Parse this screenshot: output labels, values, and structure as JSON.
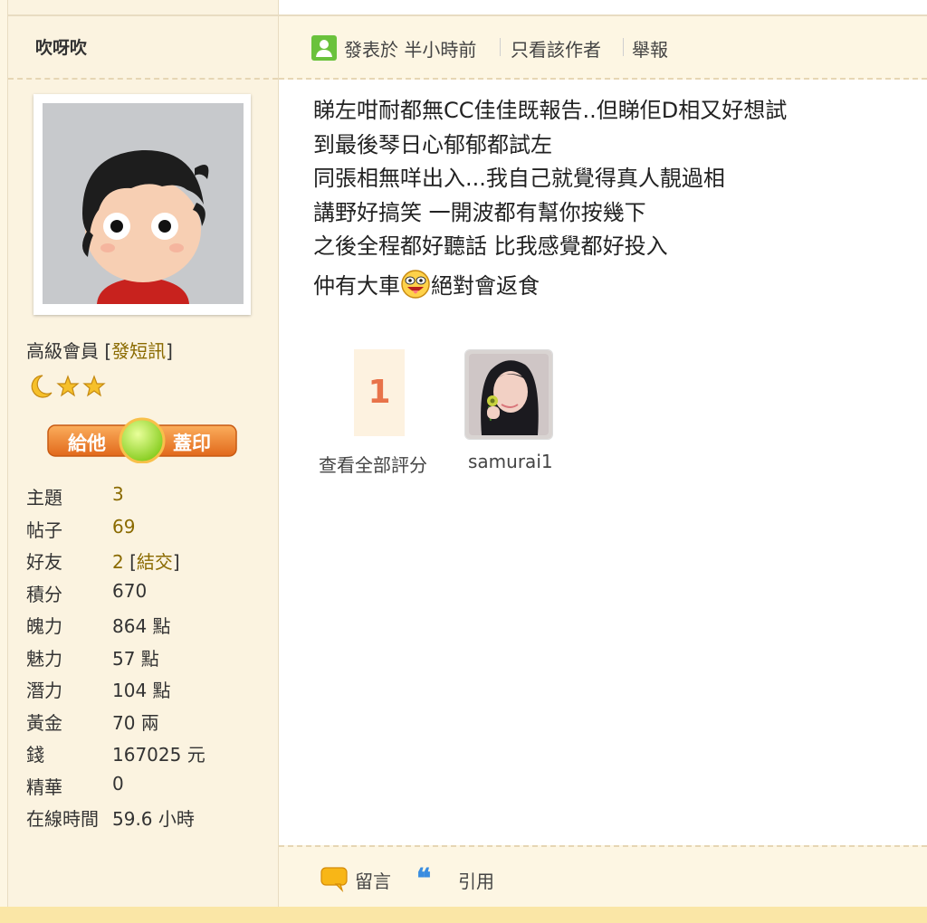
{
  "user": {
    "username": "吹呀吹",
    "rank": "高級會員",
    "pm_label": "發短訊",
    "stamp_left": "給他",
    "stamp_right": "蓋印"
  },
  "stats": [
    {
      "label": "主題",
      "value": "3"
    },
    {
      "label": "帖子",
      "value": "69"
    },
    {
      "label": "好友",
      "value": "2",
      "extra": "結交"
    },
    {
      "label": "積分",
      "value": "670"
    },
    {
      "label": "魄力",
      "value": "864 點"
    },
    {
      "label": "魅力",
      "value": "57 點"
    },
    {
      "label": "潛力",
      "value": "104 點"
    },
    {
      "label": "黃金",
      "value": "70 兩"
    },
    {
      "label": "錢",
      "value": "167025 元"
    },
    {
      "label": "精華",
      "value": "0"
    },
    {
      "label": "在線時間",
      "value": "59.6 小時"
    }
  ],
  "post": {
    "posted_time": "發表於 半小時前",
    "author_only": "只看該作者",
    "report": "舉報",
    "lines": [
      "睇左咁耐都無CC佳佳既報告..但睇佢D相又好想試",
      "到最後琴日心郁郁都試左",
      "同張相無咩出入...我自己就覺得真人靚過相",
      "講野好搞笑 一開波都有幫你按幾下",
      "之後全程都好聽話 比我感覺都好投入"
    ],
    "last_line_before": "仲有大車",
    "last_line_after": "絕對會返食"
  },
  "rating": {
    "count": "1",
    "view_all": "查看全部評分",
    "rater_name": "samurai1"
  },
  "footer": {
    "reply": "留言",
    "quote": "引用"
  },
  "colors": {
    "accent_gold": "#8a6a00",
    "online_green": "#6ac23c",
    "rating_orange": "#e8734a",
    "quote_blue": "#3a8de0"
  }
}
